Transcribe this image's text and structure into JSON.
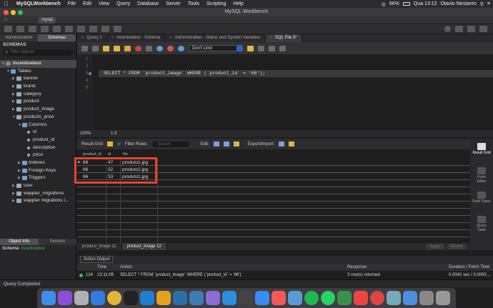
{
  "menubar": {
    "app_name": "MySQLWorkbench",
    "items": [
      "File",
      "Edit",
      "View",
      "Query",
      "Database",
      "Server",
      "Tools",
      "Scripting",
      "Help"
    ],
    "battery": "66%",
    "clock": "Qua 13:12",
    "user": "Otavio Nestares"
  },
  "window": {
    "title": "MySQL Workbench"
  },
  "connection_tab": "mysql",
  "sidebar": {
    "tabs": [
      "Administration",
      "Schemas"
    ],
    "header": "SCHEMAS",
    "filter_placeholder": "Filter objects",
    "tree": [
      {
        "label": "incentivebox",
        "icon": "database-icon"
      },
      {
        "label": "Tables",
        "icon": "folder-icon"
      },
      {
        "label": "banner",
        "icon": "table-icon"
      },
      {
        "label": "brand",
        "icon": "table-icon"
      },
      {
        "label": "category",
        "icon": "table-icon"
      },
      {
        "label": "product",
        "icon": "table-icon"
      },
      {
        "label": "product_image",
        "icon": "table-icon"
      },
      {
        "label": "products_price",
        "icon": "table-icon"
      },
      {
        "label": "Columns",
        "icon": "folder-icon"
      },
      {
        "label": "id",
        "icon": "column-icon"
      },
      {
        "label": "product_id",
        "icon": "column-icon"
      },
      {
        "label": "description",
        "icon": "column-icon"
      },
      {
        "label": "price",
        "icon": "column-icon"
      },
      {
        "label": "Indexes",
        "icon": "folder-icon"
      },
      {
        "label": "Foreign Keys",
        "icon": "folder-icon"
      },
      {
        "label": "Triggers",
        "icon": "folder-icon"
      },
      {
        "label": "user",
        "icon": "table-icon"
      },
      {
        "label": "wappler_migrations",
        "icon": "table-icon"
      },
      {
        "label": "wappler migrations l...",
        "icon": "table-icon"
      }
    ],
    "object_tabs": [
      "Object Info",
      "Session"
    ],
    "schema_label": "Schema:",
    "schema_value": "incentivebox"
  },
  "editor_tabs": [
    "Query 1",
    "incentivebox - Schema",
    "Administration - Status and System Variables",
    "SQL File 3*"
  ],
  "sql_toolbar": {
    "limit": "Don't Limit"
  },
  "editor": {
    "line_numbers": [
      "1",
      "2",
      "3",
      "4",
      "5"
    ],
    "sql": "SELECT * FROM `product_image` WHERE (`product_id` = '66');",
    "zoom": "100%",
    "cursor": "1:3"
  },
  "result_toolbar": {
    "result_grid": "Result Grid",
    "filter_rows": "Filter Rows:",
    "search_placeholder": "Search",
    "edit": "Edit:",
    "export_import": "Export/Import:"
  },
  "grid": {
    "columns": [
      "product_id",
      "id",
      "file"
    ],
    "rows": [
      [
        "66",
        "47",
        "produto1.jpg"
      ],
      [
        "66",
        "52",
        "produto2.jpg"
      ],
      [
        "66",
        "53",
        "produto1.jpg"
      ]
    ]
  },
  "result_tabs": [
    "product_image 11",
    "product_image 12"
  ],
  "result_buttons": {
    "apply": "Apply",
    "revert": "Revert"
  },
  "right_panel": [
    "Result Grid",
    "Form Editor",
    "Field Types",
    "Query Stats"
  ],
  "output": {
    "selector": "Action Output",
    "columns": [
      "Time",
      "Action",
      "Response",
      "Duration / Fetch Time"
    ],
    "row": {
      "num": "124",
      "time": "13:11:06",
      "action": "SELECT * FROM `product_image` WHERE (`product_id` = '66')",
      "response": "3 row(s) returned",
      "duration": "0.0042 sec / 0.0000..."
    }
  },
  "status": "Query Completed",
  "colors": {
    "accent": "#e6442e",
    "success": "#3fb950",
    "selection": "#2a64c5"
  }
}
